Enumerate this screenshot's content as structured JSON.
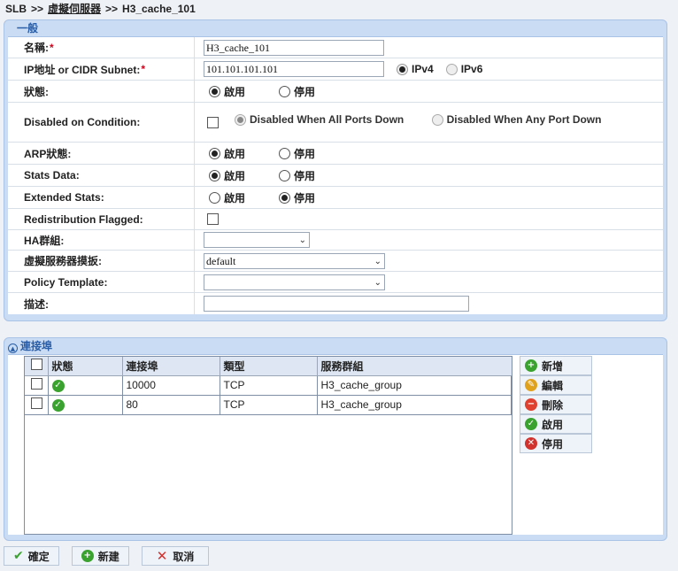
{
  "breadcrumb": {
    "root": "SLB",
    "sep": ">>",
    "parent": "虛擬伺服器",
    "current": "H3_cache_101"
  },
  "general": {
    "title": "一般",
    "name_label": "名稱:",
    "name_value": "H3_cache_101",
    "ip_label": "IP地址 or CIDR Subnet:",
    "ip_value": "101.101.101.101",
    "ipv4_label": "IPv4",
    "ipv6_label": "IPv6",
    "status_label": "狀態:",
    "enable_label": "啟用",
    "disable_label": "停用",
    "disabled_condition_label": "Disabled on Condition:",
    "cond_all_ports": "Disabled When All Ports Down",
    "cond_any_port": "Disabled When Any Port Down",
    "arp_label": "ARP狀態:",
    "stats_data_label": "Stats Data:",
    "extended_stats_label": "Extended Stats:",
    "redistribution_label": "Redistribution Flagged:",
    "ha_group_label": "HA群組:",
    "ha_group_value": "",
    "vs_template_label": "虛擬服務器摸扳:",
    "vs_template_value": "default",
    "policy_template_label": "Policy Template:",
    "policy_template_value": "",
    "desc_label": "描述:",
    "desc_value": ""
  },
  "ports": {
    "title": "連接埠",
    "columns": [
      "狀態",
      "連接埠",
      "類型",
      "服務群組"
    ],
    "rows": [
      {
        "port": "10000",
        "type": "TCP",
        "group": "H3_cache_group"
      },
      {
        "port": "80",
        "type": "TCP",
        "group": "H3_cache_group"
      }
    ],
    "actions": {
      "add": "新增",
      "edit": "編輯",
      "delete": "刪除",
      "enable": "啟用",
      "disable": "停用"
    }
  },
  "footer": {
    "ok": "確定",
    "new": "新建",
    "cancel": "取消"
  }
}
